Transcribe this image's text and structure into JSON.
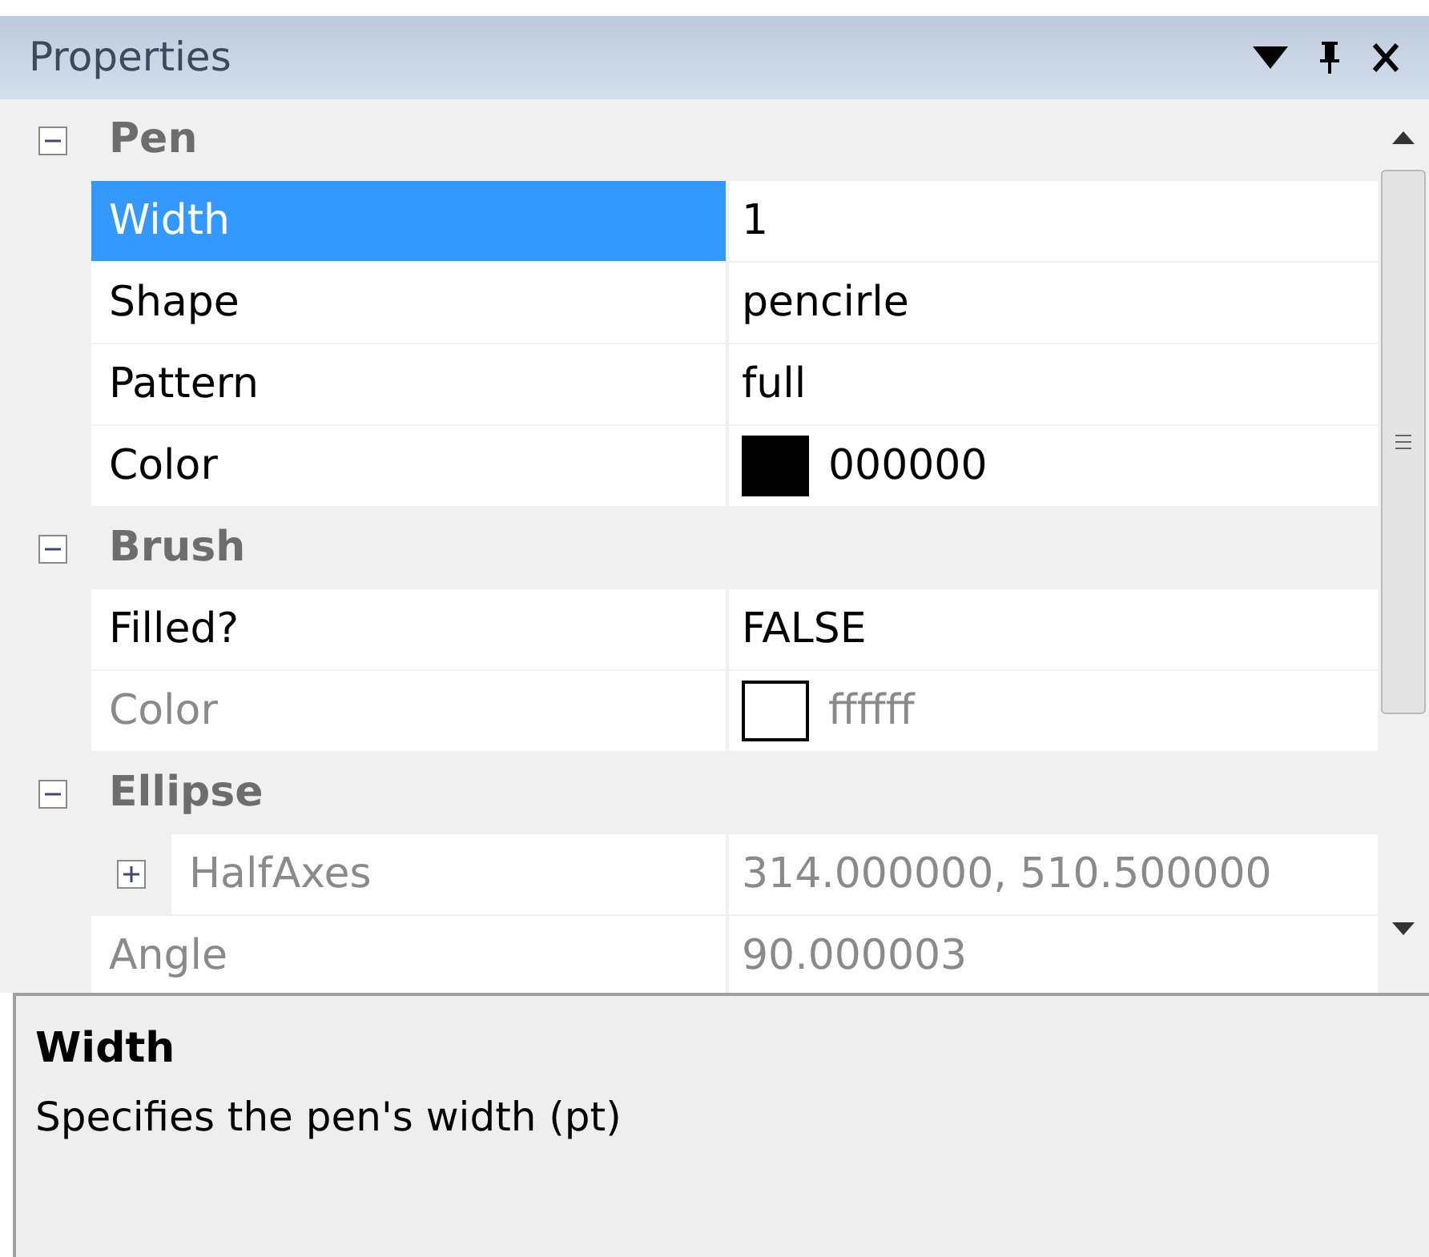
{
  "panel": {
    "title": "Properties"
  },
  "categories": [
    {
      "label": "Pen",
      "expanded": true,
      "properties": [
        {
          "name": "Width",
          "value": "1",
          "selected": true,
          "disabled": false
        },
        {
          "name": "Shape",
          "value": "pencirle",
          "selected": false,
          "disabled": false
        },
        {
          "name": "Pattern",
          "value": "full",
          "selected": false,
          "disabled": false
        },
        {
          "name": "Color",
          "value": "000000",
          "selected": false,
          "disabled": false,
          "color": "#000000"
        }
      ]
    },
    {
      "label": "Brush",
      "expanded": true,
      "properties": [
        {
          "name": "Filled?",
          "value": "FALSE",
          "selected": false,
          "disabled": false
        },
        {
          "name": "Color",
          "value": "ffffff",
          "selected": false,
          "disabled": true,
          "color": "#ffffff"
        }
      ]
    },
    {
      "label": "Ellipse",
      "expanded": true,
      "properties": [
        {
          "name": "HalfAxes",
          "value": "314.000000, 510.500000",
          "selected": false,
          "disabled": true,
          "expanded": false
        },
        {
          "name": "Angle",
          "value": "90.000003",
          "selected": false,
          "disabled": true
        }
      ]
    }
  ],
  "description": {
    "title": "Width",
    "text": "Specifies the pen's width (pt)"
  }
}
